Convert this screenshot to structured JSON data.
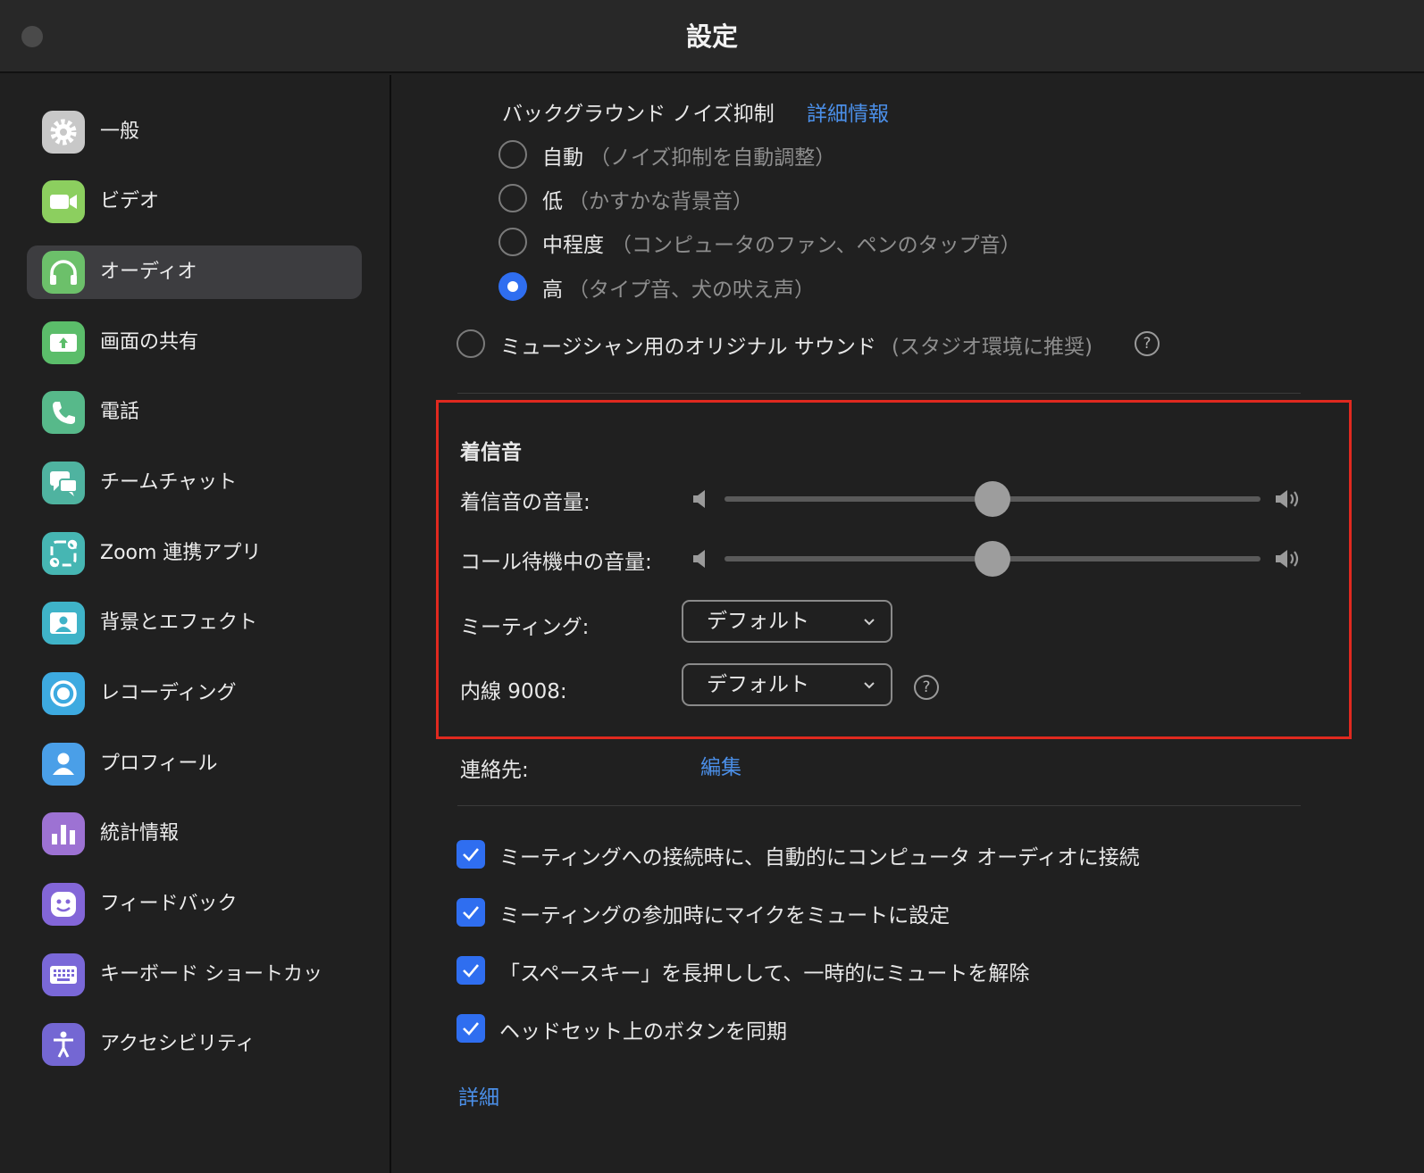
{
  "window": {
    "title": "設定"
  },
  "sidebar": {
    "items": [
      {
        "label": "一般",
        "icon": "gear-icon",
        "color": "#c8c8c8"
      },
      {
        "label": "ビデオ",
        "icon": "video-camera-icon",
        "color": "#8ccf5f"
      },
      {
        "label": "オーディオ",
        "icon": "headphones-icon",
        "color": "#6cc06a",
        "active": true
      },
      {
        "label": "画面の共有",
        "icon": "share-screen-icon",
        "color": "#5bbd6a"
      },
      {
        "label": "電話",
        "icon": "phone-icon",
        "color": "#57b98a"
      },
      {
        "label": "チームチャット",
        "icon": "chat-icon",
        "color": "#4fb3a0"
      },
      {
        "label": "Zoom 連携アプリ",
        "icon": "apps-icon",
        "color": "#46b6b3"
      },
      {
        "label": "背景とエフェクト",
        "icon": "background-person-icon",
        "color": "#3fb3c8"
      },
      {
        "label": "レコーディング",
        "icon": "record-icon",
        "color": "#3daae0"
      },
      {
        "label": "プロフィール",
        "icon": "profile-icon",
        "color": "#4a9fe8"
      },
      {
        "label": "統計情報",
        "icon": "statistics-icon",
        "color": "#9d72d3"
      },
      {
        "label": "フィードバック",
        "icon": "smiley-icon",
        "color": "#8366d8"
      },
      {
        "label": "キーボード ショートカッ",
        "icon": "keyboard-icon",
        "color": "#7a68d8"
      },
      {
        "label": "アクセシビリティ",
        "icon": "accessibility-icon",
        "color": "#7467d3"
      }
    ]
  },
  "main": {
    "noise": {
      "heading": "バックグラウンド ノイズ抑制",
      "learn_more": "詳細情報",
      "options": [
        {
          "label": "自動",
          "hint": "（ノイズ抑制を自動調整）",
          "selected": false
        },
        {
          "label": "低",
          "hint": "（かすかな背景音）",
          "selected": false
        },
        {
          "label": "中程度",
          "hint": "（コンピュータのファン、ペンのタップ音）",
          "selected": false
        },
        {
          "label": "高",
          "hint": "（タイプ音、犬の吠え声）",
          "selected": true
        }
      ]
    },
    "original_sound": {
      "label": "ミュージシャン用のオリジナル サウンド",
      "hint": "(スタジオ環境に推奨)",
      "selected": false,
      "help": "?"
    },
    "ringtone": {
      "heading": "着信音",
      "volume_label": "着信音の音量:",
      "volume_level": 0.5,
      "waiting_label": "コール待機中の音量:",
      "waiting_level": 0.5,
      "meeting_label": "ミーティング:",
      "meeting_value": "デフォルト",
      "extension_label": "内線 9008:",
      "extension_value": "デフォルト",
      "help": "?"
    },
    "contacts": {
      "label": "連絡先:",
      "edit": "編集"
    },
    "checkboxes": [
      {
        "label": "ミーティングへの接続時に、自動的にコンピュータ オーディオに接続",
        "checked": true
      },
      {
        "label": "ミーティングの参加時にマイクをミュートに設定",
        "checked": true
      },
      {
        "label": "「スペースキー」を長押しして、一時的にミュートを解除",
        "checked": true
      },
      {
        "label": "ヘッドセット上のボタンを同期",
        "checked": true
      }
    ],
    "advanced": "詳細"
  },
  "colors": {
    "accent": "#2f6ef0",
    "link": "#4b8fe8",
    "highlight_box": "#e0291f",
    "background": "#202020"
  }
}
